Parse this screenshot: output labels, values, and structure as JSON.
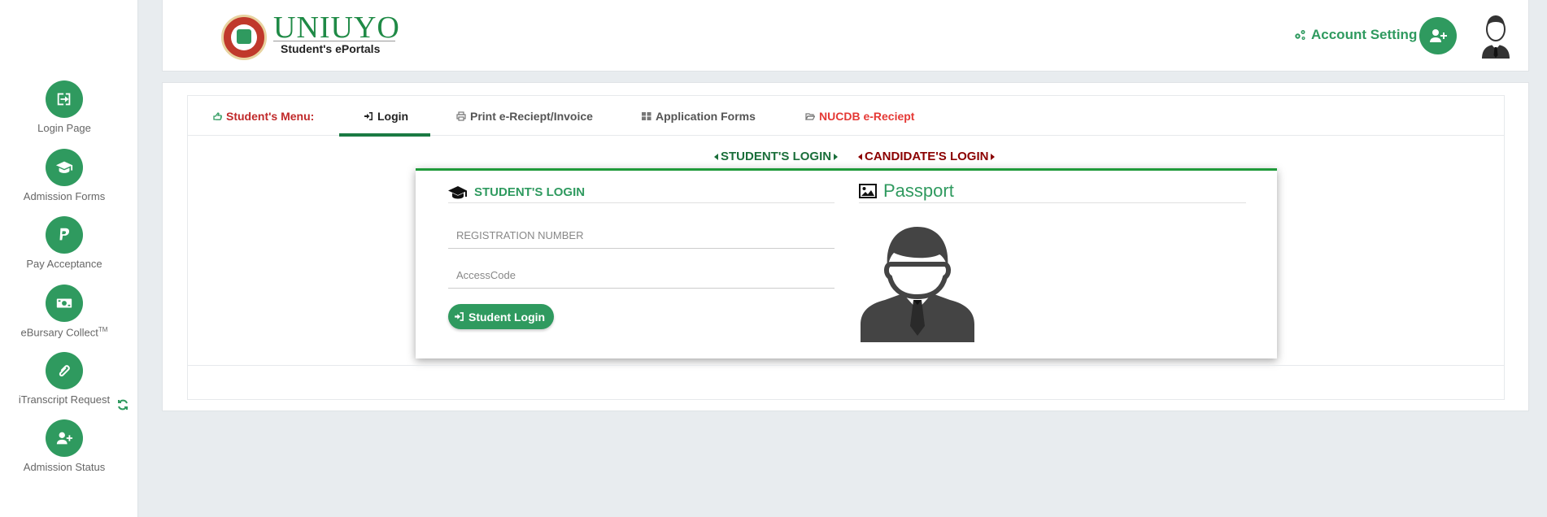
{
  "sidebar": {
    "items": [
      {
        "label": "Login Page",
        "icon": "sign-in-icon"
      },
      {
        "label": "Admission Forms",
        "icon": "graduation-cap-icon"
      },
      {
        "label": "Pay Acceptance",
        "icon": "paypal-icon"
      },
      {
        "label": "eBursary Collect",
        "sup": "TM",
        "icon": "money-icon"
      },
      {
        "label": "iTranscript Request",
        "icon": "paperclip-icon"
      },
      {
        "label": "Admission Status",
        "icon": "user-plus-icon"
      }
    ]
  },
  "header": {
    "brand": "UNIUYO",
    "brand_sub": "Student's ePortals",
    "account_label": "Account Setting"
  },
  "tabs": {
    "menu_label": "Student's Menu:",
    "login": "Login",
    "print": "Print e-Reciept/Invoice",
    "forms": "Application Forms",
    "nucdb": "NUCDB e-Reciept"
  },
  "switcher": {
    "student": "STUDENT'S LOGIN",
    "candidate": "CANDIDATE'S LOGIN"
  },
  "login_panel": {
    "title": "STUDENT'S LOGIN",
    "passport_title": "Passport",
    "reg_placeholder": "REGISTRATION NUMBER",
    "access_placeholder": "AccessCode",
    "button_label": "Student Login"
  },
  "colors": {
    "primary_green": "#2f9a5f",
    "menu_red": "#c0292a",
    "nucdb_red": "#e53935",
    "candidate_red": "#8b0000"
  }
}
